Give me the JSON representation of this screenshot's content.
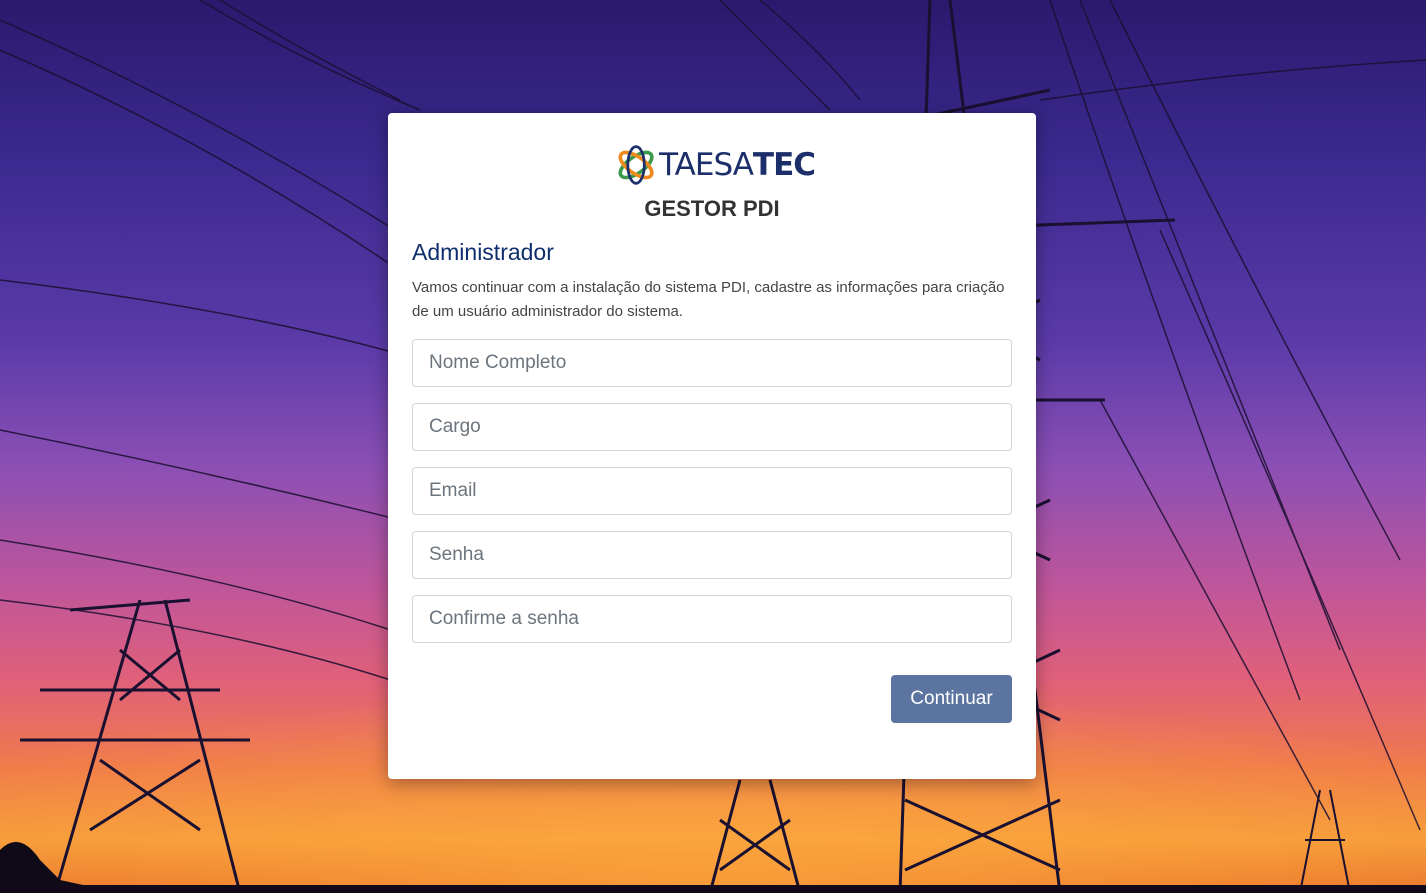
{
  "brand": {
    "logo_text_light": "TAESA",
    "logo_text_bold": "TEC",
    "app_title": "GESTOR PDI",
    "logo_colors": {
      "green": "#3a9a4a",
      "orange": "#f08a1c",
      "navy": "#1d2f6b"
    }
  },
  "form": {
    "title": "Administrador",
    "description": "Vamos continuar com a instalação do sistema PDI, cadastre as informações para criação de um usuário administrador do sistema.",
    "fields": {
      "name_placeholder": "Nome Completo",
      "role_placeholder": "Cargo",
      "email_placeholder": "Email",
      "password_placeholder": "Senha",
      "confirm_placeholder": "Confirme a senha"
    },
    "submit_label": "Continuar"
  },
  "theme": {
    "accent": "#5b75a0",
    "title_color": "#0f2e6e"
  }
}
